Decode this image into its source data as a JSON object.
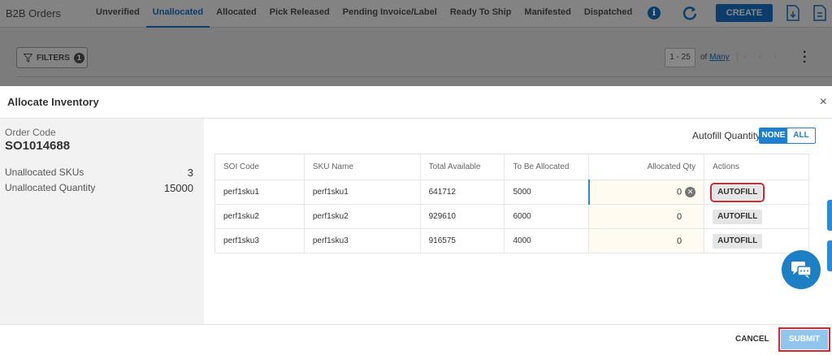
{
  "app": {
    "title": "B2B Orders",
    "tabs": [
      "Unverified",
      "Unallocated",
      "Allocated",
      "Pick Released",
      "Pending Invoice/Label",
      "Ready To Ship",
      "Manifested",
      "Dispatched"
    ],
    "active_tab": "Unallocated",
    "create_label": "CREATE",
    "filters_label": "FILTERS",
    "filters_count": "1",
    "pager_range": "1 - 25",
    "pager_of": "of",
    "pager_many": "Many"
  },
  "modal": {
    "title": "Allocate Inventory",
    "close_label": "×",
    "order_code_label": "Order Code",
    "order_code": "SO1014688",
    "unallocated_skus_label": "Unallocated SKUs",
    "unallocated_skus": "3",
    "unallocated_qty_label": "Unallocated Quantity",
    "unallocated_qty": "15000",
    "autofill_quantity_label": "Autofill Quantity",
    "toggle": {
      "none": "NONE",
      "all": "ALL",
      "selected": "NONE"
    },
    "table": {
      "headers": [
        "SOI Code",
        "SKU Name",
        "Total Available",
        "To Be Allocated",
        "Allocated Qty",
        "Actions"
      ],
      "rows": [
        {
          "soi": "perf1sku1",
          "sku": "perf1sku1",
          "available": "641712",
          "to_allocate": "5000",
          "allocated": "0",
          "action": "AUTOFILL"
        },
        {
          "soi": "perf1sku2",
          "sku": "perf1sku2",
          "available": "929610",
          "to_allocate": "6000",
          "allocated": "0",
          "action": "AUTOFILL"
        },
        {
          "soi": "perf1sku3",
          "sku": "perf1sku3",
          "available": "916575",
          "to_allocate": "4000",
          "allocated": "0",
          "action": "AUTOFILL"
        }
      ]
    },
    "cancel_label": "CANCEL",
    "submit_label": "SUBMIT"
  },
  "colors": {
    "primary": "#1f7fcf",
    "highlight": "#d9262c",
    "submit_disabled": "#90c6ee"
  }
}
